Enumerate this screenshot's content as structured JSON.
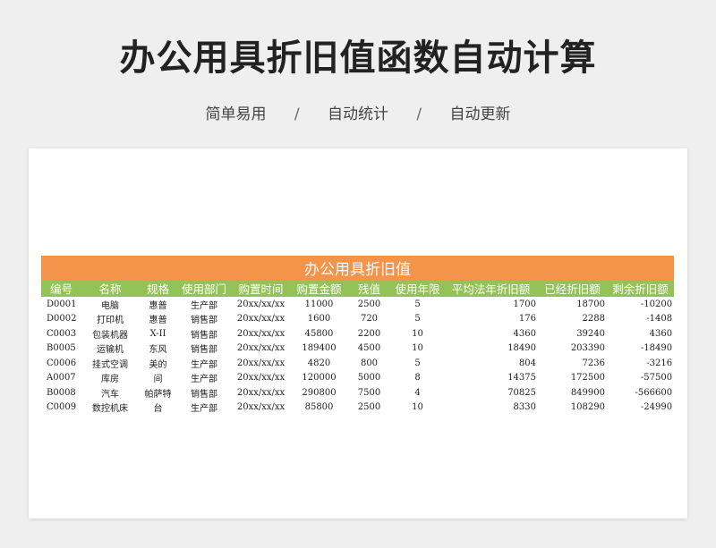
{
  "page": {
    "title": "办公用具折旧值函数自动计算",
    "subtitle": [
      "简单易用",
      "自动统计",
      "自动更新"
    ],
    "separator": "/"
  },
  "table": {
    "banner": "办公用具折旧值",
    "headers": [
      "编号",
      "名称",
      "规格",
      "使用部门",
      "购置时间",
      "购置金额",
      "残值",
      "使用年限",
      "平均法年折旧额",
      "已经折旧额",
      "剩余折旧额"
    ],
    "rows": [
      [
        "D0001",
        "电脑",
        "惠普",
        "生产部",
        "20xx/xx/xx",
        "11000",
        "2500",
        "5",
        "1700",
        "18700",
        "-10200"
      ],
      [
        "D0002",
        "打印机",
        "惠普",
        "销售部",
        "20xx/xx/xx",
        "1600",
        "720",
        "5",
        "176",
        "2288",
        "-1408"
      ],
      [
        "C0003",
        "包装机器",
        "X-II",
        "销售部",
        "20xx/xx/xx",
        "45800",
        "2200",
        "10",
        "4360",
        "39240",
        "4360"
      ],
      [
        "B0005",
        "运输机",
        "东风",
        "销售部",
        "20xx/xx/xx",
        "189400",
        "4500",
        "10",
        "18490",
        "203390",
        "-18490"
      ],
      [
        "C0006",
        "挂式空调",
        "美的",
        "生产部",
        "20xx/xx/xx",
        "4820",
        "800",
        "5",
        "804",
        "7236",
        "-3216"
      ],
      [
        "A0007",
        "库房",
        "间",
        "生产部",
        "20xx/xx/xx",
        "120000",
        "5000",
        "8",
        "14375",
        "172500",
        "-57500"
      ],
      [
        "B0008",
        "汽车",
        "帕萨特",
        "销售部",
        "20xx/xx/xx",
        "290800",
        "7500",
        "4",
        "70825",
        "849900",
        "-566600"
      ],
      [
        "C0009",
        "数控机床",
        "台",
        "生产部",
        "20xx/xx/xx",
        "85800",
        "2500",
        "10",
        "8330",
        "108290",
        "-24990"
      ]
    ]
  },
  "colors": {
    "banner": "#f4934a",
    "header": "#93c357",
    "background": "#efefef"
  }
}
